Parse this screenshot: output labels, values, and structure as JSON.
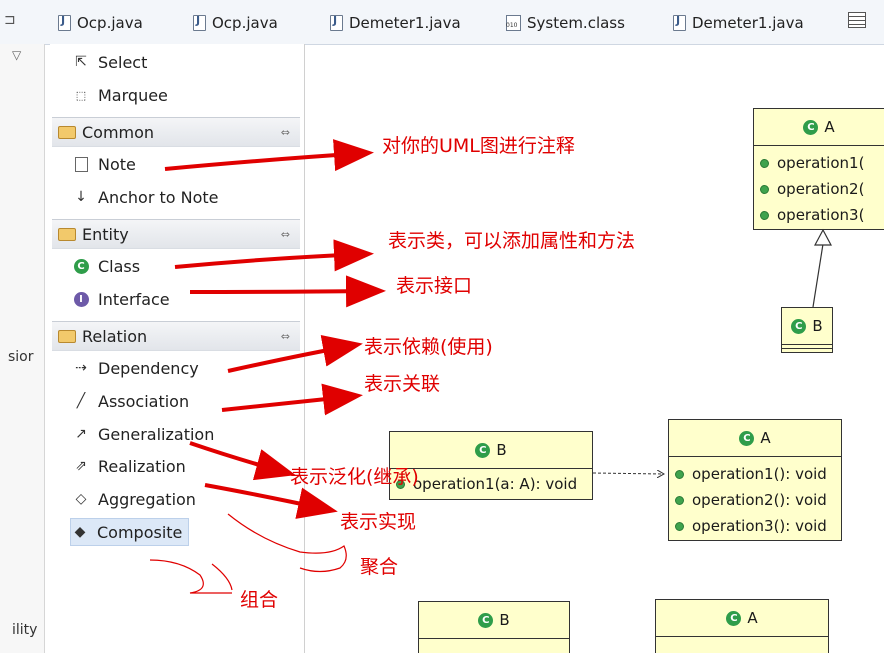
{
  "tabs": [
    {
      "label": "Ocp.java",
      "icon": "java-file-icon"
    },
    {
      "label": "Ocp.java",
      "icon": "java-file-icon"
    },
    {
      "label": "Demeter1.java",
      "icon": "java-file-icon"
    },
    {
      "label": "System.class",
      "icon": "class-file-icon"
    },
    {
      "label": "Demeter1.java",
      "icon": "java-file-icon"
    }
  ],
  "left_strip": {
    "text_1": "sior",
    "text_2": "ility"
  },
  "palette": {
    "tools": [
      {
        "label": "Select",
        "icon": "select-arrow-icon"
      },
      {
        "label": "Marquee",
        "icon": "marquee-icon"
      }
    ],
    "drawers": [
      {
        "label": "Common",
        "items": [
          {
            "label": "Note",
            "icon": "note-icon"
          },
          {
            "label": "Anchor to Note",
            "icon": "anchor-arrow-icon"
          }
        ]
      },
      {
        "label": "Entity",
        "items": [
          {
            "label": "Class",
            "icon": "class-icon"
          },
          {
            "label": "Interface",
            "icon": "interface-icon"
          }
        ]
      },
      {
        "label": "Relation",
        "items": [
          {
            "label": "Dependency",
            "icon": "dependency-icon"
          },
          {
            "label": "Association",
            "icon": "association-icon"
          },
          {
            "label": "Generalization",
            "icon": "generalization-icon"
          },
          {
            "label": "Realization",
            "icon": "realization-icon"
          },
          {
            "label": "Aggregation",
            "icon": "aggregation-icon"
          },
          {
            "label": "Composite",
            "icon": "composite-icon",
            "selected": true
          }
        ]
      }
    ]
  },
  "annotations": {
    "note": "对你的UML图进行注释",
    "class": "表示类，可以添加属性和方法",
    "interface": "表示接口",
    "dependency": "表示依赖(使用)",
    "association": "表示关联",
    "generalization": "表示泛化(继承)",
    "realization": "表示实现",
    "aggregation": "聚合",
    "composite": "组合"
  },
  "diagram": {
    "top_a": {
      "letter": "C",
      "name": "A",
      "ops": [
        "operation1(",
        "operation2(",
        "operation3("
      ]
    },
    "top_b": {
      "letter": "C",
      "name": "B"
    },
    "mid_b": {
      "letter": "C",
      "name": "B",
      "ops": [
        "operation1(a: A): void"
      ]
    },
    "mid_a": {
      "letter": "C",
      "name": "A",
      "ops": [
        "operation1(): void",
        "operation2(): void",
        "operation3(): void"
      ]
    },
    "bot_b": {
      "letter": "C",
      "name": "B"
    },
    "bot_a": {
      "letter": "C",
      "name": "A"
    }
  },
  "colors": {
    "annotation": "#e00000",
    "class_fill": "#ffffcc",
    "class_icon": "#2f9d4a",
    "interface_icon": "#6d5aa8"
  }
}
